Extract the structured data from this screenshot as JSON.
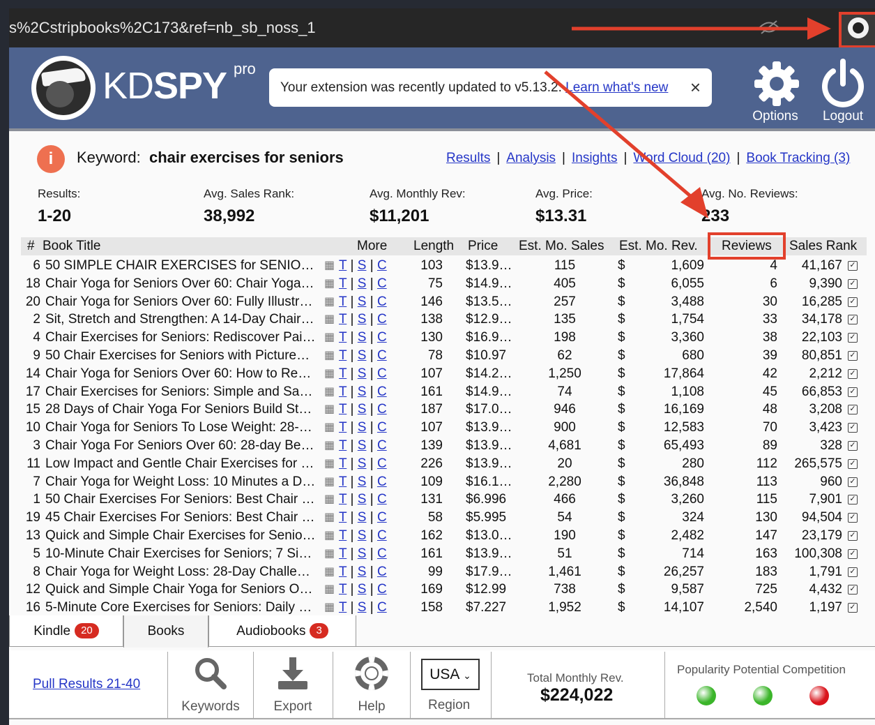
{
  "browser": {
    "url": "s%2Cstripbooks%2C173&ref=nb_sb_noss_1",
    "extension_icon": "spy-extension-icon"
  },
  "header": {
    "logo_text_light": "KD",
    "logo_text_bold": "SPY",
    "logo_pro": "pro",
    "toast_text": "Your extension was recently updated to v5.13.2. ",
    "toast_link": "Learn what's new",
    "toast_close": "×",
    "options_label": "Options",
    "logout_label": "Logout"
  },
  "keyword": {
    "label": "Keyword:",
    "value": "chair exercises for seniors",
    "links": [
      "Results",
      "Analysis",
      "Insights",
      "Word Cloud (20)",
      "Book Tracking (3)"
    ]
  },
  "stats": {
    "results_label": "Results:",
    "results_value": "1-20",
    "rank_label": "Avg. Sales Rank:",
    "rank_value": "38,992",
    "rev_label": "Avg. Monthly Rev:",
    "rev_value": "$11,201",
    "price_label": "Avg. Price:",
    "price_value": "$13.31",
    "reviews_label": "Avg. No. Reviews:",
    "reviews_value": "233"
  },
  "table": {
    "headers": {
      "num": "#",
      "title": "Book Title",
      "more": "More",
      "length": "Length",
      "price": "Price",
      "sales": "Est. Mo. Sales",
      "rev": "Est. Mo. Rev.",
      "reviews": "Reviews",
      "rank": "Sales Rank"
    },
    "link_t": "T",
    "link_s": "S",
    "link_c": "C",
    "rows": [
      {
        "num": "6",
        "title": "50 SIMPLE CHAIR EXERCISES for SENIO…",
        "length": "103",
        "price": "$13.9…",
        "sales": "115",
        "rev": "1,609",
        "reviews": "4",
        "rank": "41,167"
      },
      {
        "num": "18",
        "title": "Chair Yoga for Seniors Over 60: Chair Yoga…",
        "length": "75",
        "price": "$14.9…",
        "sales": "405",
        "rev": "6,055",
        "reviews": "6",
        "rank": "9,390"
      },
      {
        "num": "20",
        "title": "Chair Yoga for Seniors Over 60: Fully Illustr…",
        "length": "146",
        "price": "$13.5…",
        "sales": "257",
        "rev": "3,488",
        "reviews": "30",
        "rank": "16,285"
      },
      {
        "num": "2",
        "title": "Sit, Stretch and Strengthen: A 14-Day Chair…",
        "length": "138",
        "price": "$12.9…",
        "sales": "135",
        "rev": "1,754",
        "reviews": "33",
        "rank": "34,178"
      },
      {
        "num": "4",
        "title": "Chair Exercises for Seniors: Rediscover Pai…",
        "length": "130",
        "price": "$16.9…",
        "sales": "198",
        "rev": "3,360",
        "reviews": "38",
        "rank": "22,103"
      },
      {
        "num": "9",
        "title": "50 Chair Exercises for Seniors with Picture…",
        "length": "78",
        "price": "$10.97",
        "sales": "62",
        "rev": "680",
        "reviews": "39",
        "rank": "80,851"
      },
      {
        "num": "14",
        "title": "Chair Yoga for Seniors Over 60: How to Re…",
        "length": "107",
        "price": "$14.2…",
        "sales": "1,250",
        "rev": "17,864",
        "reviews": "42",
        "rank": "2,212"
      },
      {
        "num": "17",
        "title": "Chair Exercises for Seniors: Simple and Sa…",
        "length": "161",
        "price": "$14.9…",
        "sales": "74",
        "rev": "1,108",
        "reviews": "45",
        "rank": "66,853"
      },
      {
        "num": "15",
        "title": "28 Days of Chair Yoga For Seniors Build St…",
        "length": "187",
        "price": "$17.0…",
        "sales": "946",
        "rev": "16,169",
        "reviews": "48",
        "rank": "3,208"
      },
      {
        "num": "10",
        "title": "Chair Yoga for Seniors To Lose Weight: 28-…",
        "length": "107",
        "price": "$13.9…",
        "sales": "900",
        "rev": "12,583",
        "reviews": "70",
        "rank": "3,423"
      },
      {
        "num": "3",
        "title": "Chair Yoga For Seniors Over 60: 28-day Be…",
        "length": "139",
        "price": "$13.9…",
        "sales": "4,681",
        "rev": "65,493",
        "reviews": "89",
        "rank": "328"
      },
      {
        "num": "11",
        "title": "Low Impact and Gentle Chair Exercises for …",
        "length": "226",
        "price": "$13.9…",
        "sales": "20",
        "rev": "280",
        "reviews": "112",
        "rank": "265,575"
      },
      {
        "num": "7",
        "title": "Chair Yoga for Weight Loss: 10 Minutes a D…",
        "length": "109",
        "price": "$16.1…",
        "sales": "2,280",
        "rev": "36,848",
        "reviews": "113",
        "rank": "960"
      },
      {
        "num": "1",
        "title": "50 Chair Exercises For Seniors: Best Chair …",
        "length": "131",
        "price": "$6.996",
        "sales": "466",
        "rev": "3,260",
        "reviews": "115",
        "rank": "7,901"
      },
      {
        "num": "19",
        "title": "45 Chair Exercises For Seniors: Best Chair …",
        "length": "58",
        "price": "$5.995",
        "sales": "54",
        "rev": "324",
        "reviews": "130",
        "rank": "94,504"
      },
      {
        "num": "13",
        "title": "Quick and Simple Chair Exercises for Senio…",
        "length": "162",
        "price": "$13.0…",
        "sales": "190",
        "rev": "2,482",
        "reviews": "147",
        "rank": "23,179"
      },
      {
        "num": "5",
        "title": "10-Minute Chair Exercises for Seniors; 7 Si…",
        "length": "161",
        "price": "$13.9…",
        "sales": "51",
        "rev": "714",
        "reviews": "163",
        "rank": "100,308"
      },
      {
        "num": "8",
        "title": "Chair Yoga for Weight Loss: 28-Day Challe…",
        "length": "99",
        "price": "$17.9…",
        "sales": "1,461",
        "rev": "26,257",
        "reviews": "183",
        "rank": "1,791"
      },
      {
        "num": "12",
        "title": "Quick and Simple Chair Yoga for Seniors O…",
        "length": "169",
        "price": "$12.99",
        "sales": "738",
        "rev": "9,587",
        "reviews": "725",
        "rank": "4,432"
      },
      {
        "num": "16",
        "title": "5-Minute Core Exercises for Seniors: Daily …",
        "length": "158",
        "price": "$7.227",
        "sales": "1,952",
        "rev": "14,107",
        "reviews": "2,540",
        "rank": "1,197"
      }
    ]
  },
  "tabs": {
    "kindle": "Kindle",
    "kindle_count": "20",
    "books": "Books",
    "audiobooks": "Audiobooks",
    "audiobooks_count": "3"
  },
  "footer": {
    "pull_results": "Pull Results 21-40",
    "keywords": "Keywords",
    "export": "Export",
    "help": "Help",
    "region_value": "USA",
    "region_label": "Region",
    "total_rev_label": "Total Monthly Rev.",
    "total_rev_value": "$224,022",
    "meters_label": "Popularity Potential Competition",
    "meter_colors": [
      "#3bb52a",
      "#3bb52a",
      "#d9141c"
    ]
  },
  "annotation_color": "#e2402c"
}
